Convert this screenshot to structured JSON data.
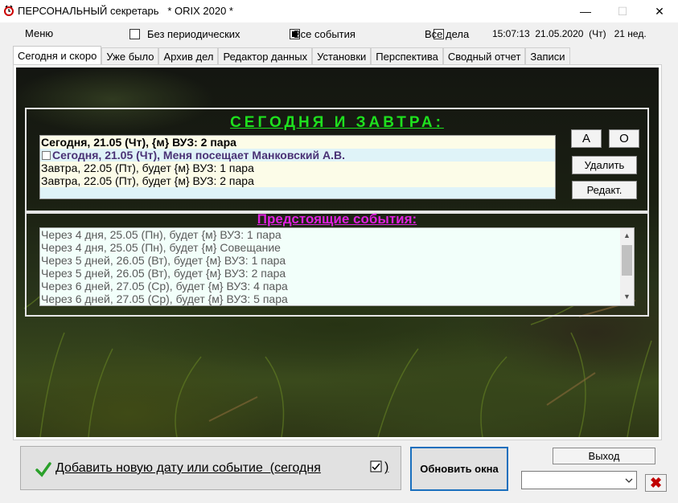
{
  "window": {
    "title": "ПЕРСОНАЛЬНЫЙ секретарь   * ORIX 2020 *",
    "minimize": "—",
    "maximize": "☐",
    "close": "✕"
  },
  "toolbar": {
    "menu_label": "Меню",
    "filters": [
      {
        "label": "Без периодических",
        "checked": false
      },
      {
        "label": "Все события",
        "checked": true
      },
      {
        "label": "Все дела",
        "checked": false
      }
    ],
    "clock": "15:07:13  21.05.2020  (Чт)   21 нед."
  },
  "tabs": [
    {
      "label": "Сегодня и скоро",
      "active": true
    },
    {
      "label": "Уже было",
      "active": false
    },
    {
      "label": "Архив дел",
      "active": false
    },
    {
      "label": "Редактор данных",
      "active": false
    },
    {
      "label": "Установки",
      "active": false
    },
    {
      "label": "Перспектива",
      "active": false
    },
    {
      "label": "Сводный отчет",
      "active": false
    },
    {
      "label": "Записи",
      "active": false
    }
  ],
  "today": {
    "title": "СЕГОДНЯ И ЗАВТРА:",
    "rows": [
      {
        "text": "Сегодня, 21.05 (Чт), {м} ВУЗ: 2 пара",
        "style": "bold",
        "bg": "#fcfce8",
        "color": "#000000"
      },
      {
        "text": "Сегодня, 21.05 (Чт), Меня посещает Манковский А.В.",
        "style": "bold",
        "bg": "#dff3f8",
        "color": "#4a3275",
        "checkbox": true
      },
      {
        "text": "Завтра, 22.05 (Пт), будет {м} ВУЗ: 1 пара",
        "style": "normal",
        "bg": "#fcfce8",
        "color": "#000000"
      },
      {
        "text": "Завтра, 22.05 (Пт), будет {м} ВУЗ: 2 пара",
        "style": "normal",
        "bg": "#fcfce8",
        "color": "#000000"
      }
    ],
    "buttons": {
      "a": "А",
      "o": "О",
      "delete": "Удалить",
      "edit": "Редакт."
    }
  },
  "upcoming": {
    "title": "Предстоящие события:",
    "rows": [
      "Через   4 дня, 25.05 (Пн), будет {м} ВУЗ: 1 пара",
      "Через   4 дня, 25.05 (Пн), будет {м} Совещание",
      "Через   5 дней, 26.05 (Вт), будет {м} ВУЗ: 1 пара",
      "Через   5 дней, 26.05 (Вт), будет {м} ВУЗ: 2 пара",
      "Через   6 дней, 27.05 (Ср), будет {м} ВУЗ: 4 пара",
      "Через   6 дней, 27.05 (Ср), будет {м} ВУЗ: 5 пара"
    ]
  },
  "bottom": {
    "add_label": "Добавить новую дату или событие  (сегодня",
    "refresh_label": "Обновить окна",
    "exit_label": "Выход",
    "combo_value": "",
    "close_x": "✖"
  },
  "colors": {
    "today_title": "#1ee01e",
    "upcoming_title": "#e020e0",
    "refresh_border": "#1a6fbd",
    "x_button": "#c00000"
  }
}
